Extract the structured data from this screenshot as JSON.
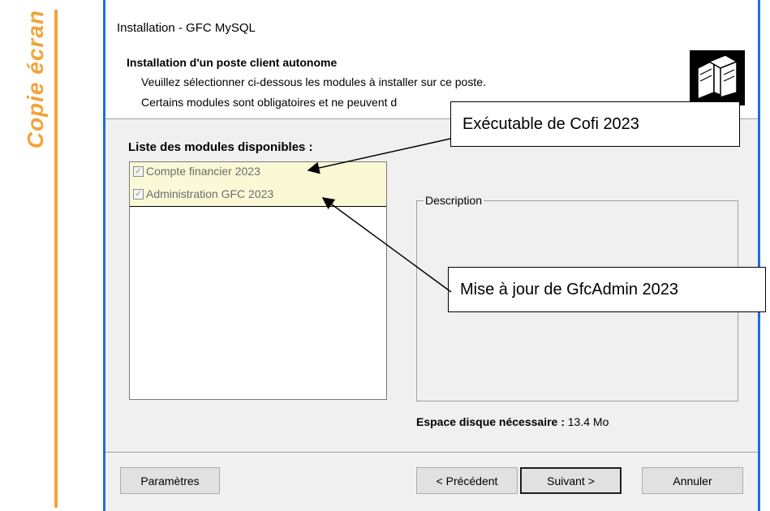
{
  "side_label": "Copie écran",
  "window": {
    "title": "Installation - GFC MySQL"
  },
  "header": {
    "title": "Installation d'un poste client autonome",
    "line1": "Veuillez sélectionner ci-dessous les modules à installer sur ce poste.",
    "line2": "Certains modules sont obligatoires et ne peuvent d"
  },
  "modules": {
    "title": "Liste des modules disponibles :",
    "items": [
      {
        "label": "Compte financier 2023",
        "checked": true
      },
      {
        "label": "Administration GFC 2023",
        "checked": true
      }
    ]
  },
  "description": {
    "legend": "Description"
  },
  "disk": {
    "label": "Espace disque nécessaire :",
    "value": "13.4 Mo"
  },
  "buttons": {
    "params": "Paramètres",
    "previous": "< Précédent",
    "next": "Suivant >",
    "cancel": "Annuler"
  },
  "callouts": {
    "c1": "Exécutable de Cofi 2023",
    "c2": "Mise à jour de GfcAdmin 2023"
  }
}
